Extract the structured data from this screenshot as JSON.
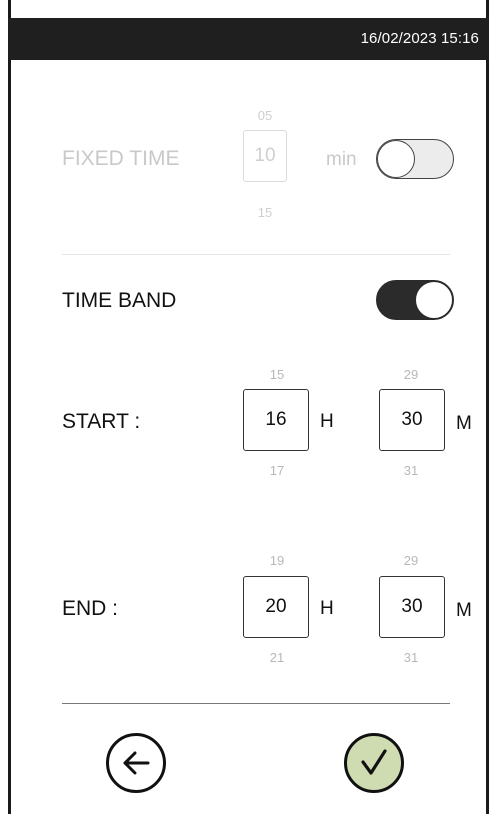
{
  "header": {
    "datetime": "16/02/2023 15:16"
  },
  "fixed_time": {
    "label": "FIXED TIME",
    "prev": "05",
    "value": "10",
    "next": "15",
    "unit": "min",
    "enabled": false
  },
  "time_band": {
    "label": "TIME BAND",
    "enabled": true
  },
  "start": {
    "label": "START :",
    "hour": {
      "prev": "15",
      "value": "16",
      "next": "17",
      "unit": "H"
    },
    "minute": {
      "prev": "29",
      "value": "30",
      "next": "31",
      "unit": "M"
    }
  },
  "end": {
    "label": "END :",
    "hour": {
      "prev": "19",
      "value": "20",
      "next": "21",
      "unit": "H"
    },
    "minute": {
      "prev": "29",
      "value": "30",
      "next": "31",
      "unit": "M"
    }
  },
  "footer": {
    "back_icon": "arrow-left-icon",
    "confirm_icon": "checkmark-icon",
    "confirm_color": "#cfdcb1"
  }
}
